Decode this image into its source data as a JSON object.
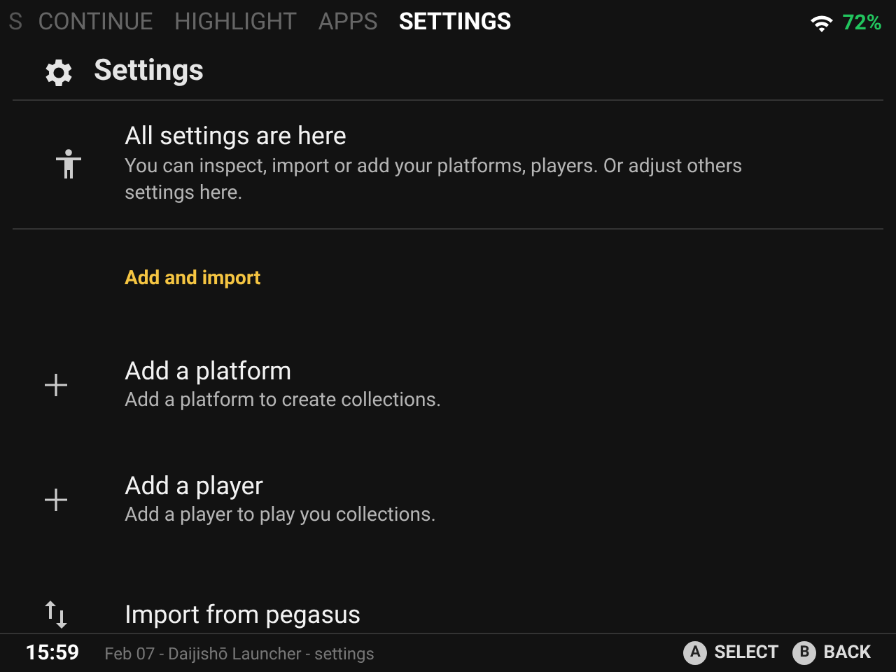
{
  "tabs": [
    {
      "label": "S",
      "selected": false,
      "faded": true
    },
    {
      "label": "CONTINUE",
      "selected": false,
      "faded": false
    },
    {
      "label": "HIGHLIGHT",
      "selected": false,
      "faded": false
    },
    {
      "label": "APPS",
      "selected": false,
      "faded": false
    },
    {
      "label": "SETTINGS",
      "selected": true,
      "faded": false
    }
  ],
  "status": {
    "battery": "72%"
  },
  "page_title": "Settings",
  "intro": {
    "title": "All settings are here",
    "text": "You can inspect, import or add your platforms, players. Or adjust others settings here."
  },
  "section": "Add and import",
  "items": [
    {
      "kind": "plus",
      "title": "Add a platform",
      "subtitle": "Add a platform to create collections."
    },
    {
      "kind": "plus",
      "title": "Add a player",
      "subtitle": "Add a player to play you collections."
    },
    {
      "kind": "swap",
      "title": "Import from pegasus"
    }
  ],
  "footer": {
    "time": "15:59",
    "info": "Feb 07 - Daijishō Launcher - settings",
    "buttons": [
      {
        "key": "A",
        "label": "SELECT"
      },
      {
        "key": "B",
        "label": "BACK"
      }
    ]
  }
}
